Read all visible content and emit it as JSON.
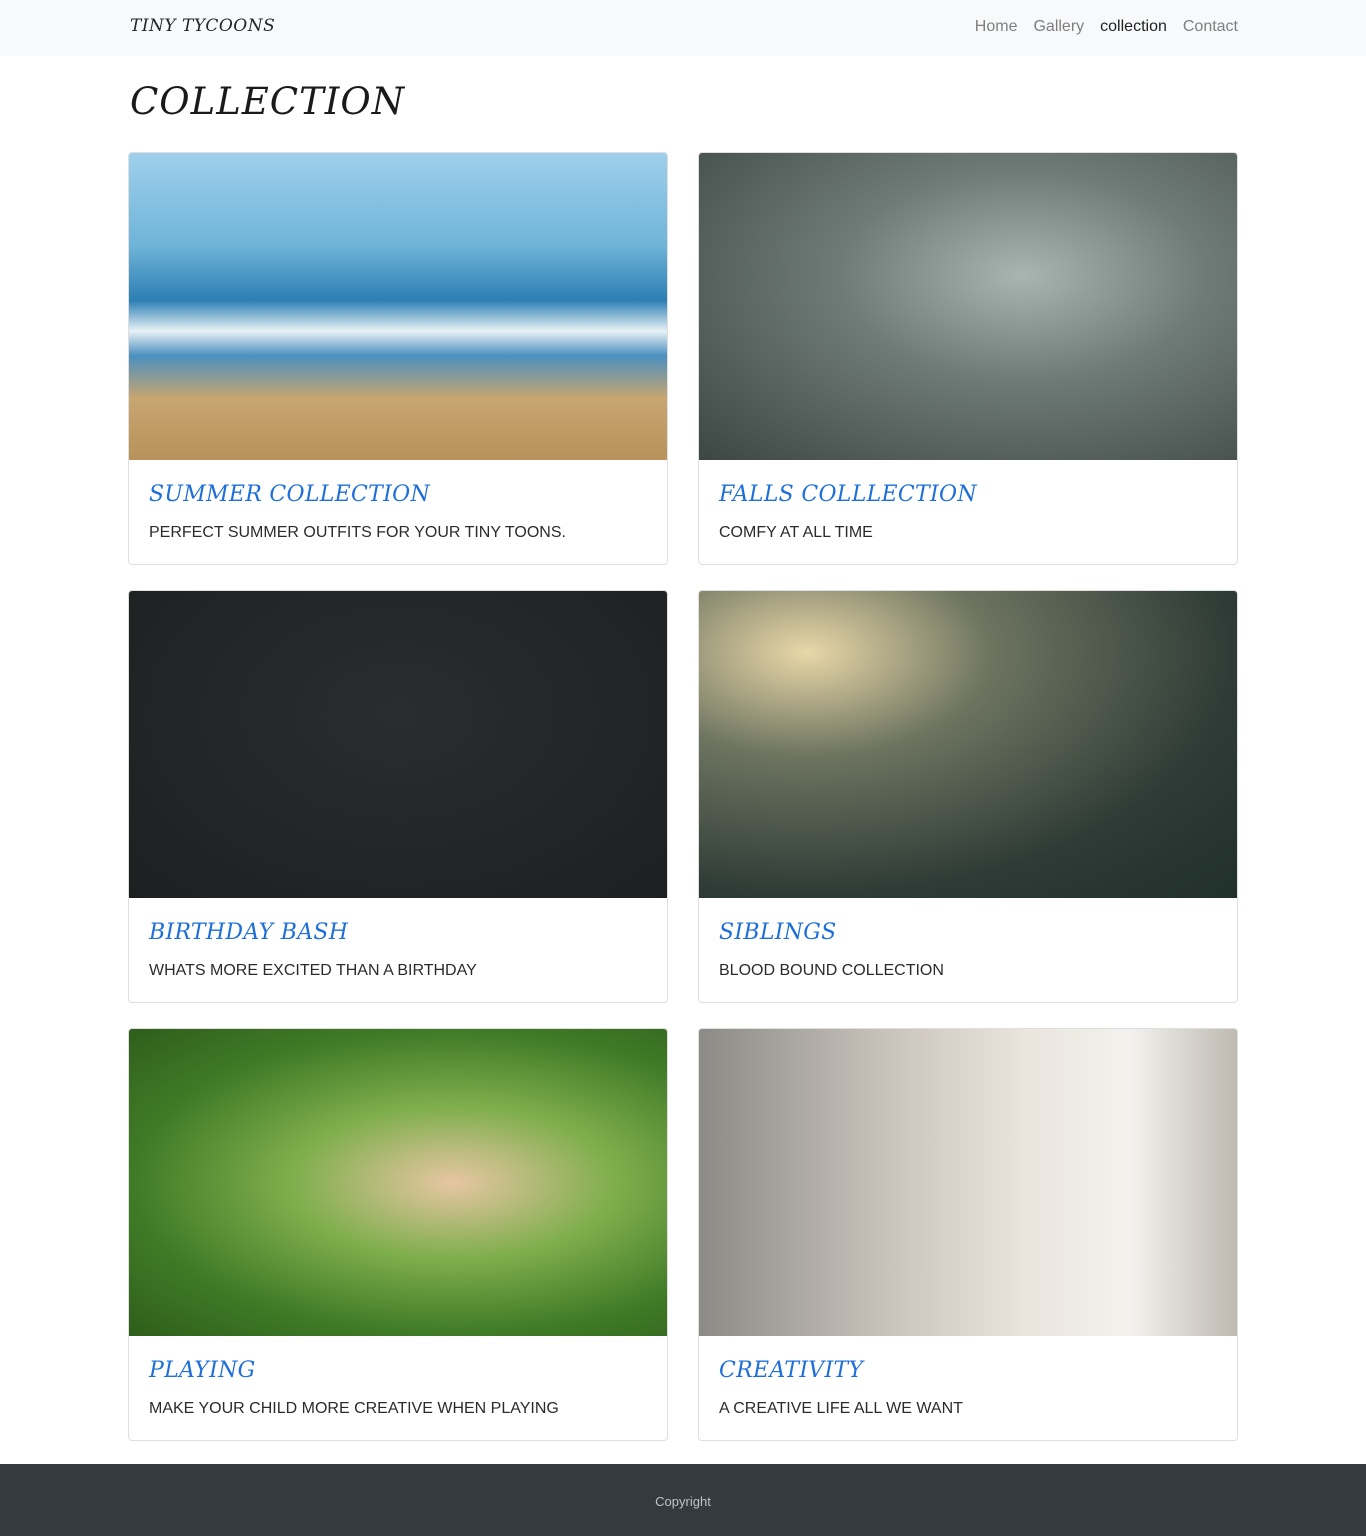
{
  "navbar": {
    "brand": "TINY TYCOONS",
    "links": [
      {
        "label": "Home"
      },
      {
        "label": "Gallery"
      },
      {
        "label": "collection"
      },
      {
        "label": "Contact"
      }
    ]
  },
  "page": {
    "title": "COLLECTION"
  },
  "cards": [
    {
      "title": "SUMMER COLLECTION",
      "text": "PERFECT SUMMER OUTFITS FOR YOUR TINY TOONS."
    },
    {
      "title": "FALLS COLLLECTION",
      "text": "COMFY AT ALL TIME"
    },
    {
      "title": "BIRTHDAY BASH",
      "text": "WHATS MORE EXCITED THAN A BIRTHDAY"
    },
    {
      "title": "SIBLINGS",
      "text": "BLOOD BOUND COLLECTION"
    },
    {
      "title": "PLAYING",
      "text": "MAKE YOUR CHILD MORE CREATIVE WHEN PLAYING"
    },
    {
      "title": "CREATIVITY",
      "text": "A CREATIVE LIFE ALL WE WANT"
    }
  ],
  "footer": {
    "text": "Copyright"
  },
  "colors": {
    "navbar_bg": "#f8f9fa",
    "card_title": "#1e6fd9",
    "footer_bg": "#343a40"
  }
}
